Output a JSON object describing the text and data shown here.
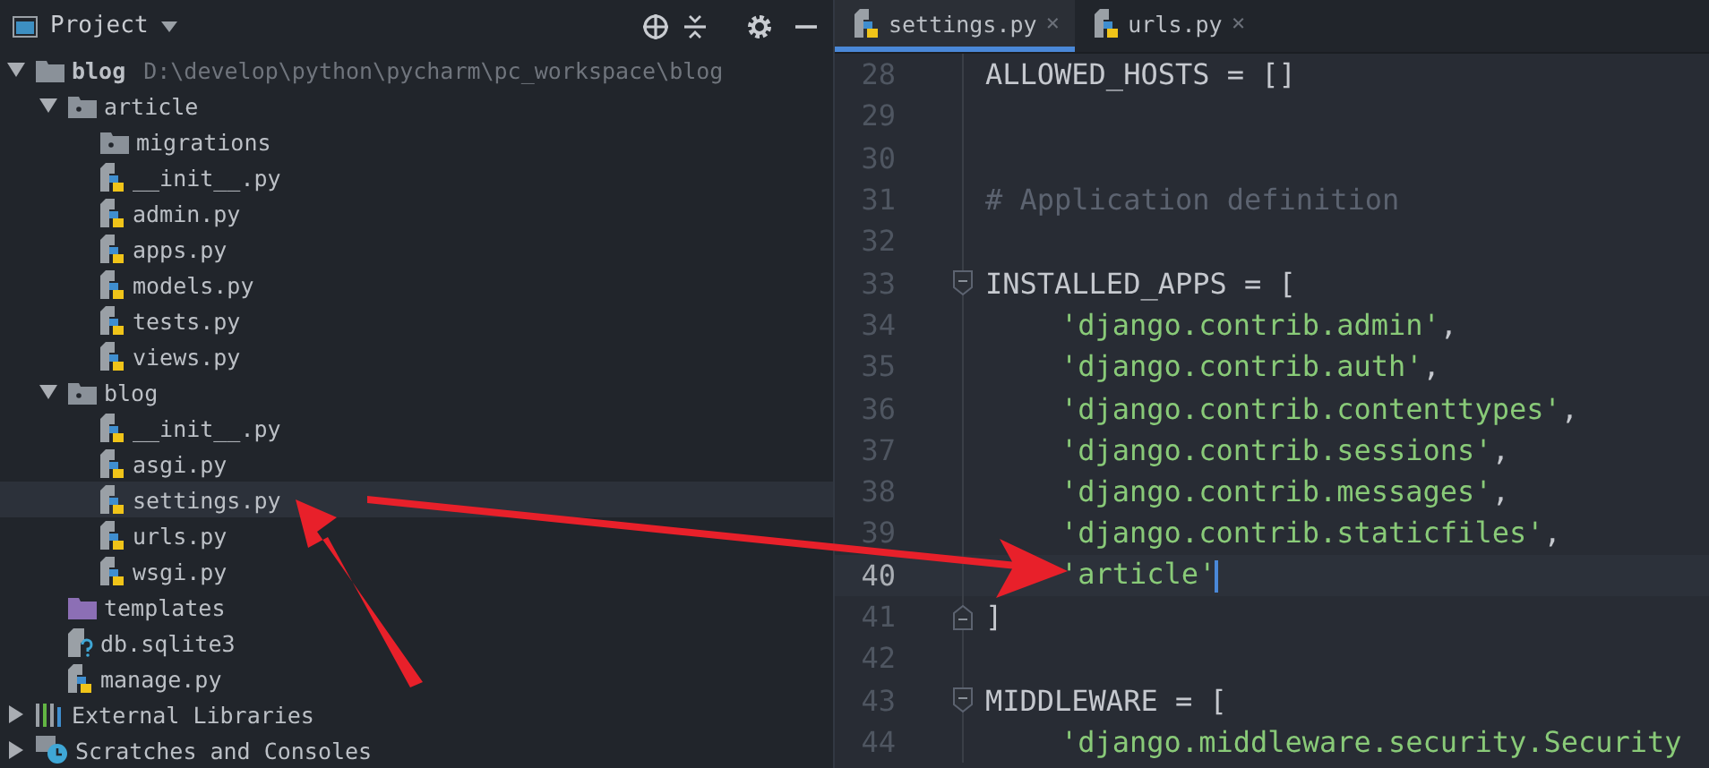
{
  "project_panel": {
    "title": "Project",
    "tree": [
      {
        "label": "blog",
        "kind": "folder",
        "path": "D:\\develop\\python\\pycharm\\pc_workspace\\blog",
        "expanded": true,
        "selected": false,
        "children": [
          {
            "label": "article",
            "kind": "package",
            "expanded": true,
            "selected": false,
            "children": [
              {
                "label": "migrations",
                "kind": "package",
                "expanded": false,
                "selected": false
              },
              {
                "label": "__init__.py",
                "kind": "python",
                "selected": false
              },
              {
                "label": "admin.py",
                "kind": "python",
                "selected": false
              },
              {
                "label": "apps.py",
                "kind": "python",
                "selected": false
              },
              {
                "label": "models.py",
                "kind": "python",
                "selected": false
              },
              {
                "label": "tests.py",
                "kind": "python",
                "selected": false
              },
              {
                "label": "views.py",
                "kind": "python",
                "selected": false
              }
            ]
          },
          {
            "label": "blog",
            "kind": "package",
            "expanded": true,
            "selected": false,
            "children": [
              {
                "label": "__init__.py",
                "kind": "python",
                "selected": false
              },
              {
                "label": "asgi.py",
                "kind": "python",
                "selected": false
              },
              {
                "label": "settings.py",
                "kind": "python",
                "selected": true
              },
              {
                "label": "urls.py",
                "kind": "python",
                "selected": false
              },
              {
                "label": "wsgi.py",
                "kind": "python",
                "selected": false
              }
            ]
          },
          {
            "label": "templates",
            "kind": "templates",
            "selected": false
          },
          {
            "label": "db.sqlite3",
            "kind": "unknown",
            "selected": false
          },
          {
            "label": "manage.py",
            "kind": "python",
            "selected": false
          }
        ]
      },
      {
        "label": "External Libraries",
        "kind": "libraries",
        "expanded": false,
        "selected": false
      },
      {
        "label": "Scratches and Consoles",
        "kind": "scratches",
        "expanded": false,
        "selected": false
      }
    ]
  },
  "editor": {
    "tabs": [
      {
        "label": "settings.py",
        "close": "×",
        "selected": true
      },
      {
        "label": "urls.py",
        "close": "×",
        "selected": false
      }
    ],
    "lines": [
      {
        "number": "28",
        "kind": "code",
        "text": "ALLOWED_HOSTS = []",
        "current": false
      },
      {
        "number": "29",
        "kind": "blank",
        "current": false
      },
      {
        "number": "30",
        "kind": "blank",
        "current": false
      },
      {
        "number": "31",
        "kind": "comment",
        "text": "# Application definition",
        "current": false
      },
      {
        "number": "32",
        "kind": "blank",
        "current": false
      },
      {
        "number": "33",
        "kind": "code",
        "text": "INSTALLED_APPS = [",
        "fold_start": true,
        "current": false
      },
      {
        "number": "34",
        "kind": "string",
        "text": "'django.contrib.admin'",
        "suffix": ",",
        "current": false
      },
      {
        "number": "35",
        "kind": "string",
        "text": "'django.contrib.auth'",
        "suffix": ",",
        "current": false
      },
      {
        "number": "36",
        "kind": "string",
        "text": "'django.contrib.contenttypes'",
        "suffix": ",",
        "current": false
      },
      {
        "number": "37",
        "kind": "string",
        "text": "'django.contrib.sessions'",
        "suffix": ",",
        "current": false
      },
      {
        "number": "38",
        "kind": "string",
        "text": "'django.contrib.messages'",
        "suffix": ",",
        "current": false
      },
      {
        "number": "39",
        "kind": "string",
        "text": "'django.contrib.staticfiles'",
        "suffix": ",",
        "current": false
      },
      {
        "number": "40",
        "kind": "string",
        "text": "'article'",
        "current": true
      },
      {
        "number": "41",
        "kind": "code",
        "text": "]",
        "fold_end": true,
        "current": false
      },
      {
        "number": "42",
        "kind": "blank",
        "current": false
      },
      {
        "number": "43",
        "kind": "code",
        "text": "MIDDLEWARE = [",
        "fold_start": true,
        "current": false
      },
      {
        "number": "44",
        "kind": "string",
        "text": "'django.middleware.security.Security",
        "current": false
      }
    ]
  }
}
